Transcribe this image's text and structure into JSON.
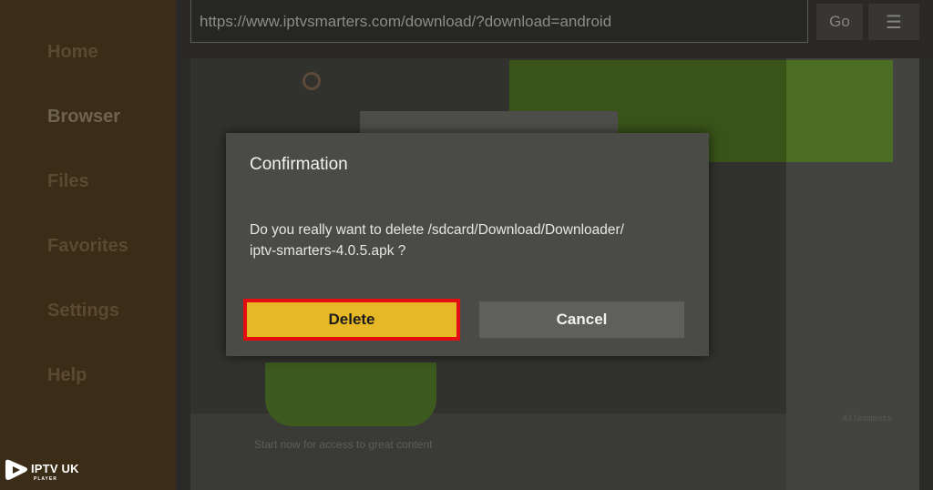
{
  "sidebar": {
    "items": [
      {
        "label": "Home"
      },
      {
        "label": "Browser"
      },
      {
        "label": "Files"
      },
      {
        "label": "Favorites"
      },
      {
        "label": "Settings"
      },
      {
        "label": "Help"
      }
    ],
    "active": "Browser"
  },
  "logo": {
    "title": "IPTV UK",
    "subtitle": "PLAYER",
    "icon": "play-icon"
  },
  "toolbar": {
    "url": "https://www.iptvsmarters.com/download/?download=android",
    "go_label": "Go",
    "menu_icon": "hamburger-menu-icon"
  },
  "webpage": {
    "start_text": "Start now for access to great content",
    "side_text": "Alloaments"
  },
  "dialog": {
    "title": "Confirmation",
    "message_line1": "Do you really want to delete /sdcard/Download/Downloader/",
    "message_line2": "iptv-smarters-4.0.5.apk ?",
    "delete_label": "Delete",
    "cancel_label": "Cancel"
  },
  "colors": {
    "highlight_border": "#e40d12",
    "delete_button": "#e6b825",
    "sidebar_bg": "#3b2c17",
    "dialog_bg": "#4a4a47"
  }
}
